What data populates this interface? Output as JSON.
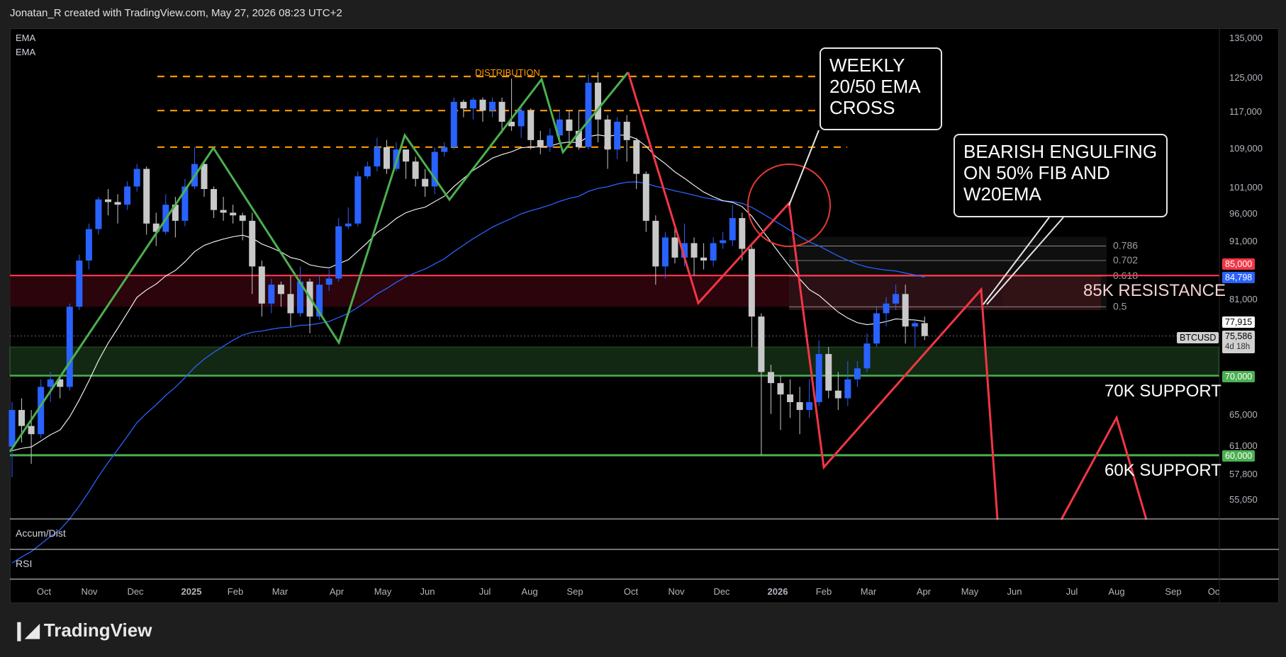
{
  "header": {
    "attribution": "Jonatan_R created with TradingView.com, May 27, 2026 08:23 UTC+2"
  },
  "legend": {
    "ema1": "EMA",
    "ema2": "EMA"
  },
  "panes": {
    "accum": "Accum/Dist",
    "rsi": "RSI"
  },
  "annotations": {
    "distribution": "DISTRIBUTION",
    "ema_cross": [
      "WEEKLY",
      "20/50 EMA",
      "CROSS"
    ],
    "engulfing": [
      "BEARISH ENGULFING",
      "ON 50% FIB AND",
      "W20EMA"
    ],
    "resistance_85k": "85K RESISTANCE",
    "support_70k": "70K SUPPORT",
    "support_60k": "60K SUPPORT"
  },
  "fib_levels": [
    "0.786",
    "0.702",
    "0.618",
    "0.5"
  ],
  "price_tags": {
    "res": "85,000",
    "ema50": "84,798",
    "ema20": "77,915",
    "symbol": "BTCUSD",
    "last": "75,586",
    "countdown": "4d 18h",
    "sup70": "70,000",
    "sup60": "60,000"
  },
  "colors": {
    "bull": "#2962ff",
    "bear": "#c8c8c8",
    "green_lines": "#4caf50",
    "red_lines": "#f23645",
    "orange": "#ff9800",
    "ema20": "#ffffff",
    "ema50": "#2962ff"
  },
  "chart_data": {
    "type": "candlestick",
    "symbol": "BTCUSD",
    "timeframe": "1W",
    "y_axis_ticks": [
      "135,000",
      "125,000",
      "117,000",
      "109,000",
      "101,000",
      "96,000",
      "91,000",
      "81,000",
      "65,000",
      "61,000",
      "57,800",
      "55,050"
    ],
    "x_axis_ticks": [
      "Oct",
      "Nov",
      "Dec",
      "2025",
      "Feb",
      "Mar",
      "Apr",
      "May",
      "Jun",
      "Jul",
      "Aug",
      "Sep",
      "Oct",
      "Nov",
      "Dec",
      "2026",
      "Feb",
      "Mar",
      "Apr",
      "May",
      "Jun",
      "Jul",
      "Aug",
      "Sep",
      "Oc"
    ],
    "horizontal_levels": {
      "resistance": 85000,
      "support_70k": 70000,
      "support_60k": 60000
    },
    "distribution_levels": [
      125000,
      117000,
      109000
    ],
    "last_price": 75586,
    "ema20_last": 77915,
    "ema50_last": 84798,
    "candles": [
      {
        "o": 61000,
        "c": 65500,
        "h": 66500,
        "l": 57500
      },
      {
        "o": 65500,
        "c": 63500,
        "h": 67000,
        "l": 61500
      },
      {
        "o": 63500,
        "c": 62500,
        "h": 65500,
        "l": 59000
      },
      {
        "o": 62500,
        "c": 68500,
        "h": 69500,
        "l": 62000
      },
      {
        "o": 68500,
        "c": 69500,
        "h": 70500,
        "l": 66500
      },
      {
        "o": 69500,
        "c": 68500,
        "h": 70000,
        "l": 67000
      },
      {
        "o": 68500,
        "c": 80000,
        "h": 80500,
        "l": 68000
      },
      {
        "o": 80000,
        "c": 87500,
        "h": 88500,
        "l": 79500
      },
      {
        "o": 87500,
        "c": 93000,
        "h": 94000,
        "l": 86000
      },
      {
        "o": 93000,
        "c": 98500,
        "h": 99000,
        "l": 92000
      },
      {
        "o": 98500,
        "c": 98000,
        "h": 100500,
        "l": 95500
      },
      {
        "o": 98000,
        "c": 97500,
        "h": 99500,
        "l": 94000
      },
      {
        "o": 97500,
        "c": 101000,
        "h": 102000,
        "l": 96500
      },
      {
        "o": 101000,
        "c": 104500,
        "h": 105500,
        "l": 100000
      },
      {
        "o": 104500,
        "c": 94000,
        "h": 105000,
        "l": 92000
      },
      {
        "o": 94000,
        "c": 92500,
        "h": 96000,
        "l": 90000
      },
      {
        "o": 92500,
        "c": 97500,
        "h": 99500,
        "l": 92000
      },
      {
        "o": 97500,
        "c": 94500,
        "h": 99000,
        "l": 91500
      },
      {
        "o": 94500,
        "c": 101000,
        "h": 102500,
        "l": 93500
      },
      {
        "o": 101000,
        "c": 105500,
        "h": 109000,
        "l": 100500
      },
      {
        "o": 105500,
        "c": 100500,
        "h": 106000,
        "l": 99000
      },
      {
        "o": 100500,
        "c": 96500,
        "h": 101000,
        "l": 95000
      },
      {
        "o": 96500,
        "c": 96000,
        "h": 99000,
        "l": 94500
      },
      {
        "o": 96000,
        "c": 95500,
        "h": 97500,
        "l": 94000
      },
      {
        "o": 95500,
        "c": 94500,
        "h": 96000,
        "l": 91000
      },
      {
        "o": 94500,
        "c": 86500,
        "h": 96000,
        "l": 82000
      },
      {
        "o": 86500,
        "c": 80500,
        "h": 87500,
        "l": 78500
      },
      {
        "o": 80500,
        "c": 83500,
        "h": 84500,
        "l": 79000
      },
      {
        "o": 83500,
        "c": 82000,
        "h": 84000,
        "l": 80000
      },
      {
        "o": 82000,
        "c": 79000,
        "h": 85000,
        "l": 77000
      },
      {
        "o": 79000,
        "c": 84000,
        "h": 86500,
        "l": 78500
      },
      {
        "o": 84000,
        "c": 78500,
        "h": 84500,
        "l": 76000
      },
      {
        "o": 78500,
        "c": 83500,
        "h": 85000,
        "l": 78000
      },
      {
        "o": 83500,
        "c": 84500,
        "h": 86000,
        "l": 82500
      },
      {
        "o": 84500,
        "c": 93500,
        "h": 95000,
        "l": 84000
      },
      {
        "o": 93500,
        "c": 94000,
        "h": 97000,
        "l": 93000
      },
      {
        "o": 94000,
        "c": 103000,
        "h": 104000,
        "l": 93500
      },
      {
        "o": 103000,
        "c": 105000,
        "h": 106000,
        "l": 102500
      },
      {
        "o": 105000,
        "c": 109000,
        "h": 111000,
        "l": 104000
      },
      {
        "o": 109000,
        "c": 104500,
        "h": 110500,
        "l": 103500
      },
      {
        "o": 104500,
        "c": 108500,
        "h": 110000,
        "l": 104000
      },
      {
        "o": 108500,
        "c": 106000,
        "h": 108500,
        "l": 102500
      },
      {
        "o": 106000,
        "c": 102500,
        "h": 107000,
        "l": 101000
      },
      {
        "o": 102500,
        "c": 101000,
        "h": 104500,
        "l": 99000
      },
      {
        "o": 101000,
        "c": 108000,
        "h": 109000,
        "l": 99500
      },
      {
        "o": 108000,
        "c": 109000,
        "h": 110000,
        "l": 107000
      },
      {
        "o": 109000,
        "c": 119000,
        "h": 120000,
        "l": 108500
      },
      {
        "o": 119000,
        "c": 117500,
        "h": 119500,
        "l": 115500
      },
      {
        "o": 117500,
        "c": 119500,
        "h": 120000,
        "l": 115000
      },
      {
        "o": 119500,
        "c": 117000,
        "h": 120000,
        "l": 114500
      },
      {
        "o": 117000,
        "c": 119000,
        "h": 120000,
        "l": 115500
      },
      {
        "o": 119000,
        "c": 114500,
        "h": 120000,
        "l": 112000
      },
      {
        "o": 114500,
        "c": 113500,
        "h": 124500,
        "l": 112500
      },
      {
        "o": 113500,
        "c": 117000,
        "h": 118500,
        "l": 111000
      },
      {
        "o": 117000,
        "c": 110500,
        "h": 117500,
        "l": 108500
      },
      {
        "o": 110500,
        "c": 109000,
        "h": 112500,
        "l": 107500
      },
      {
        "o": 109000,
        "c": 111500,
        "h": 113000,
        "l": 108000
      },
      {
        "o": 111500,
        "c": 115000,
        "h": 117000,
        "l": 110500
      },
      {
        "o": 115000,
        "c": 112500,
        "h": 117000,
        "l": 109500
      },
      {
        "o": 112500,
        "c": 109000,
        "h": 117000,
        "l": 108500
      },
      {
        "o": 109000,
        "c": 123500,
        "h": 125500,
        "l": 108500
      },
      {
        "o": 123500,
        "c": 115000,
        "h": 126000,
        "l": 110000
      },
      {
        "o": 115000,
        "c": 108500,
        "h": 116000,
        "l": 104500
      },
      {
        "o": 108500,
        "c": 114500,
        "h": 115500,
        "l": 106500
      },
      {
        "o": 114500,
        "c": 110500,
        "h": 116000,
        "l": 106000
      },
      {
        "o": 110500,
        "c": 103500,
        "h": 111000,
        "l": 100500
      },
      {
        "o": 103500,
        "c": 94500,
        "h": 104000,
        "l": 92500
      },
      {
        "o": 94500,
        "c": 86500,
        "h": 95500,
        "l": 83500
      },
      {
        "o": 86500,
        "c": 91500,
        "h": 92500,
        "l": 84500
      },
      {
        "o": 91500,
        "c": 88000,
        "h": 93500,
        "l": 87000
      },
      {
        "o": 88000,
        "c": 90500,
        "h": 94000,
        "l": 86500
      },
      {
        "o": 90500,
        "c": 88000,
        "h": 91500,
        "l": 85000
      },
      {
        "o": 88000,
        "c": 87500,
        "h": 90500,
        "l": 86000
      },
      {
        "o": 87500,
        "c": 90500,
        "h": 91500,
        "l": 86500
      },
      {
        "o": 90500,
        "c": 91000,
        "h": 92500,
        "l": 89500
      },
      {
        "o": 91000,
        "c": 95000,
        "h": 97500,
        "l": 90000
      },
      {
        "o": 95000,
        "c": 89500,
        "h": 96000,
        "l": 87500
      },
      {
        "o": 89500,
        "c": 78500,
        "h": 90000,
        "l": 74000
      },
      {
        "o": 78500,
        "c": 70500,
        "h": 79000,
        "l": 60000
      },
      {
        "o": 70500,
        "c": 69000,
        "h": 71500,
        "l": 65000
      },
      {
        "o": 69000,
        "c": 67500,
        "h": 70000,
        "l": 63000
      },
      {
        "o": 67500,
        "c": 66500,
        "h": 69500,
        "l": 64500
      },
      {
        "o": 66500,
        "c": 65500,
        "h": 68500,
        "l": 62500
      },
      {
        "o": 65500,
        "c": 66500,
        "h": 69500,
        "l": 64500
      },
      {
        "o": 66500,
        "c": 73000,
        "h": 75000,
        "l": 66000
      },
      {
        "o": 73000,
        "c": 68000,
        "h": 74000,
        "l": 67000
      },
      {
        "o": 68000,
        "c": 67000,
        "h": 70500,
        "l": 65500
      },
      {
        "o": 67000,
        "c": 69500,
        "h": 72000,
        "l": 66000
      },
      {
        "o": 69500,
        "c": 71000,
        "h": 72000,
        "l": 68500
      },
      {
        "o": 71000,
        "c": 74500,
        "h": 76000,
        "l": 70500
      },
      {
        "o": 74500,
        "c": 79000,
        "h": 80000,
        "l": 74000
      },
      {
        "o": 79000,
        "c": 80500,
        "h": 81500,
        "l": 77000
      },
      {
        "o": 80500,
        "c": 82000,
        "h": 83500,
        "l": 79500
      },
      {
        "o": 82000,
        "c": 77000,
        "h": 83500,
        "l": 74500
      },
      {
        "o": 77000,
        "c": 77500,
        "h": 78000,
        "l": 74000
      },
      {
        "o": 77500,
        "c": 75586,
        "h": 78500,
        "l": 75000
      }
    ]
  }
}
